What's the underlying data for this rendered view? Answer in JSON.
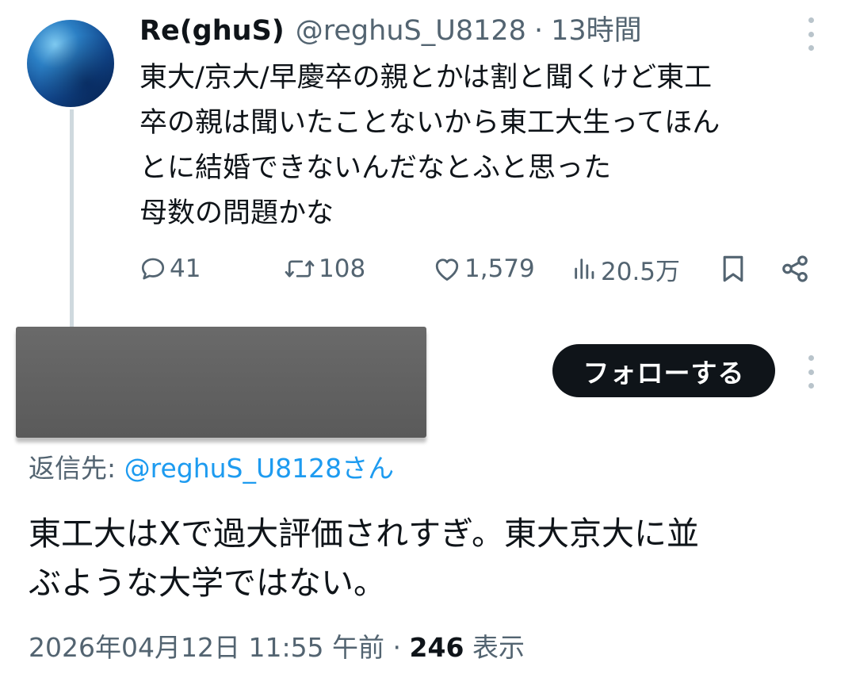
{
  "parent_tweet": {
    "display_name": "Re(ghuS)",
    "handle": "@reghuS_U8128",
    "separator": "·",
    "time": "13時間",
    "body_lines": [
      "東大/京大/早慶卒の親とかは割と聞くけど東工",
      "卒の親は聞いたことないから東工大生ってほん",
      "とに結婚できないんだなとふと思った",
      "母数の問題かな"
    ],
    "actions": {
      "replies": "41",
      "retweets": "108",
      "likes": "1,579",
      "views": "20.5万"
    },
    "icons": {
      "avatar": "avatar",
      "more": "more-vertical-icon",
      "reply": "reply-icon",
      "retweet": "retweet-icon",
      "like": "heart-icon",
      "views": "views-chart-icon",
      "bookmark": "bookmark-icon",
      "share": "share-icon"
    }
  },
  "reply_tweet": {
    "follow_label": "フォローする",
    "reply_to_prefix": "返信先: ",
    "reply_to_handle": "@reghuS_U8128さん",
    "body_lines": [
      "東工大はXで過大評価されすぎ。東大京大に並",
      "ぶような大学ではない。"
    ],
    "timestamp": "2026年04月12日 11:55 午前",
    "separator": "·",
    "views_count": "246",
    "views_label": "表示"
  },
  "colors": {
    "text_primary": "#0f1419",
    "text_secondary": "#536471",
    "link": "#1d9bf0",
    "follow_button_bg": "#0f1419",
    "thread_line": "#cfd9de",
    "redaction": "#5f5f5f"
  }
}
